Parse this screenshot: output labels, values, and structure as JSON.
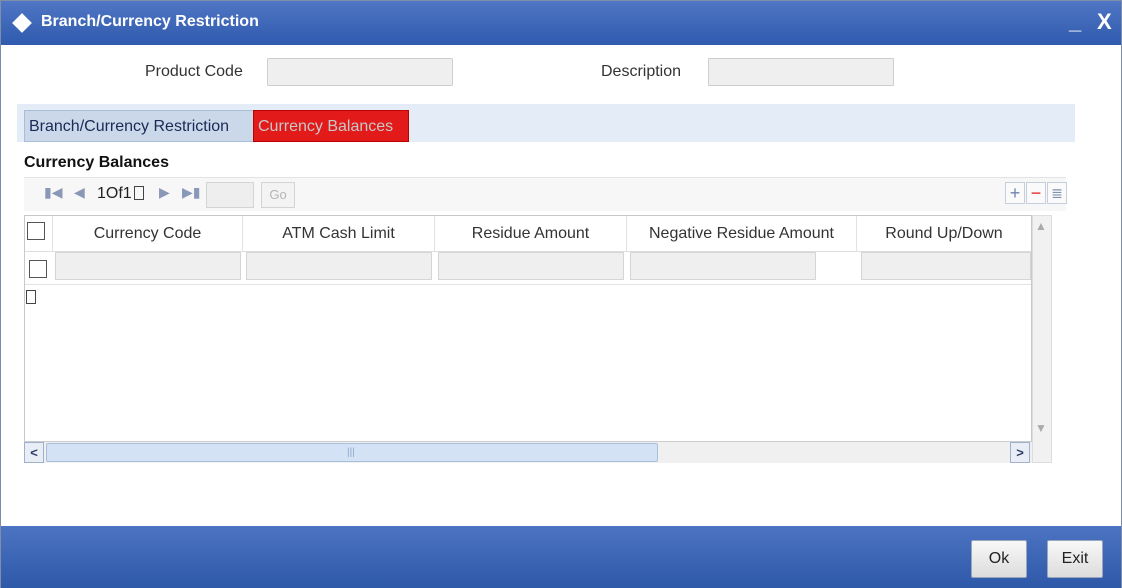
{
  "window": {
    "title": "Branch/Currency Restriction",
    "minimize_label": "_",
    "close_label": "X"
  },
  "form": {
    "product_code_label": "Product Code",
    "product_code_value": "",
    "description_label": "Description",
    "description_value": ""
  },
  "tabs": [
    {
      "label": "Branch/Currency Restriction",
      "active": false
    },
    {
      "label": "Currency Balances",
      "active": true
    }
  ],
  "section": {
    "title": "Currency Balances"
  },
  "pagination": {
    "indicator": "1Of1",
    "go_label": "Go",
    "page_value": ""
  },
  "grid": {
    "columns": [
      "Currency Code",
      "ATM Cash Limit",
      "Residue Amount",
      "Negative Residue Amount",
      "Round Up/Down"
    ],
    "rows": [
      {
        "cells": [
          "",
          "",
          "",
          "",
          ""
        ]
      }
    ]
  },
  "buttons": {
    "add": "+",
    "delete": "−",
    "single_view": "≣",
    "ok": "Ok",
    "exit": "Exit"
  },
  "colors": {
    "titlebar": "#3a64b8",
    "active_tab": "#e21a1a",
    "inactive_tab": "#cad8ea",
    "footer": "#3a64b8"
  }
}
